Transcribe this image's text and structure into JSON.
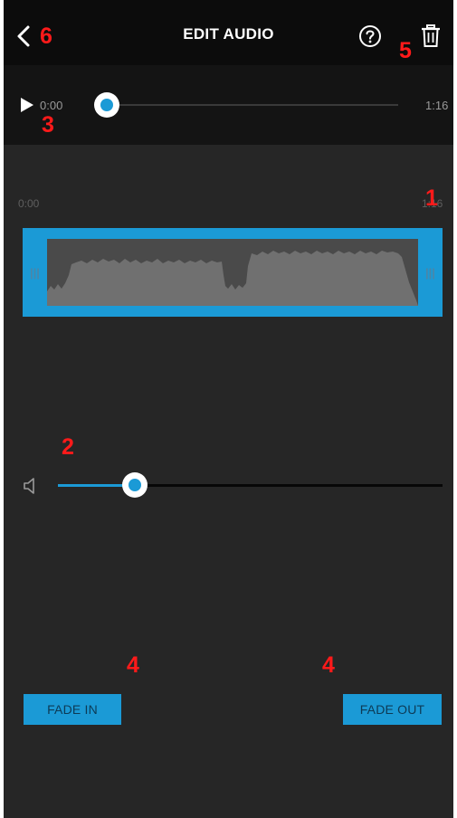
{
  "header": {
    "title": "EDIT AUDIO",
    "back_icon": "chevron-left-icon",
    "help_icon": "question-circle-icon",
    "delete_icon": "trash-icon"
  },
  "player": {
    "play_icon": "play-icon",
    "current_time": "0:00",
    "total_time": "1:16",
    "progress": 0.0
  },
  "waveform": {
    "start_label": "0:00",
    "end_label": "1:16",
    "handle_left": "|||",
    "handle_right": "|||"
  },
  "volume": {
    "icon": "speaker-icon",
    "level": 0.2
  },
  "buttons": {
    "fade_in": "FADE IN",
    "fade_out": "FADE OUT"
  },
  "annotations": {
    "m1": "1",
    "m2": "2",
    "m3": "3",
    "m4a": "4",
    "m4b": "4",
    "m5": "5",
    "m6": "6"
  },
  "colors": {
    "accent": "#1b9ad6",
    "annotation": "#ff1a1a",
    "background": "#262626"
  }
}
